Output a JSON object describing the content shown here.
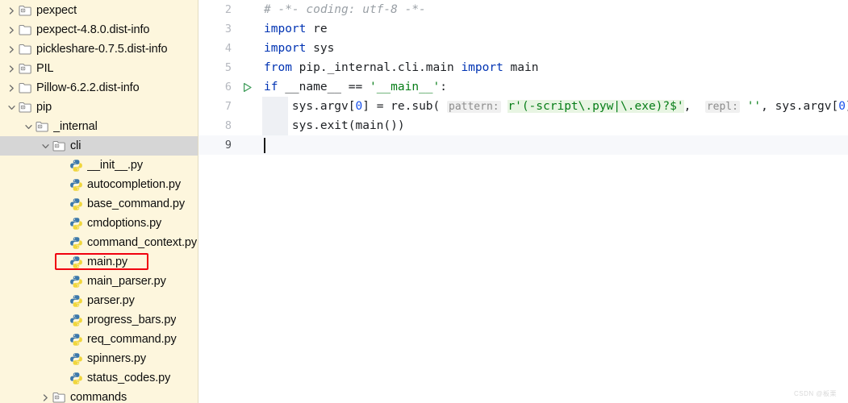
{
  "sidebar": {
    "background_color": "#fdf6dd",
    "selected_row_color": "#d6d6d6",
    "annotation_color": "#f0000f",
    "items": [
      {
        "label": "pexpect",
        "indent": 0,
        "arrow": "collapsed",
        "icon": "module-folder-icon",
        "selected": false,
        "annotated": false
      },
      {
        "label": "pexpect-4.8.0.dist-info",
        "indent": 0,
        "arrow": "collapsed",
        "icon": "folder-icon",
        "selected": false,
        "annotated": false
      },
      {
        "label": "pickleshare-0.7.5.dist-info",
        "indent": 0,
        "arrow": "collapsed",
        "icon": "folder-icon",
        "selected": false,
        "annotated": false
      },
      {
        "label": "PIL",
        "indent": 0,
        "arrow": "collapsed",
        "icon": "module-folder-icon",
        "selected": false,
        "annotated": false
      },
      {
        "label": "Pillow-6.2.2.dist-info",
        "indent": 0,
        "arrow": "collapsed",
        "icon": "folder-icon",
        "selected": false,
        "annotated": false
      },
      {
        "label": "pip",
        "indent": 0,
        "arrow": "expanded",
        "icon": "module-folder-icon",
        "selected": false,
        "annotated": false
      },
      {
        "label": "_internal",
        "indent": 1,
        "arrow": "expanded",
        "icon": "module-folder-icon",
        "selected": false,
        "annotated": false
      },
      {
        "label": "cli",
        "indent": 2,
        "arrow": "expanded",
        "icon": "module-folder-icon",
        "selected": true,
        "annotated": false
      },
      {
        "label": "__init__.py",
        "indent": 3,
        "arrow": "none",
        "icon": "python-file-icon",
        "selected": false,
        "annotated": false
      },
      {
        "label": "autocompletion.py",
        "indent": 3,
        "arrow": "none",
        "icon": "python-file-icon",
        "selected": false,
        "annotated": false
      },
      {
        "label": "base_command.py",
        "indent": 3,
        "arrow": "none",
        "icon": "python-file-icon",
        "selected": false,
        "annotated": false
      },
      {
        "label": "cmdoptions.py",
        "indent": 3,
        "arrow": "none",
        "icon": "python-file-icon",
        "selected": false,
        "annotated": false
      },
      {
        "label": "command_context.py",
        "indent": 3,
        "arrow": "none",
        "icon": "python-file-icon",
        "selected": false,
        "annotated": false
      },
      {
        "label": "main.py",
        "indent": 3,
        "arrow": "none",
        "icon": "python-file-icon",
        "selected": false,
        "annotated": true
      },
      {
        "label": "main_parser.py",
        "indent": 3,
        "arrow": "none",
        "icon": "python-file-icon",
        "selected": false,
        "annotated": false
      },
      {
        "label": "parser.py",
        "indent": 3,
        "arrow": "none",
        "icon": "python-file-icon",
        "selected": false,
        "annotated": false
      },
      {
        "label": "progress_bars.py",
        "indent": 3,
        "arrow": "none",
        "icon": "python-file-icon",
        "selected": false,
        "annotated": false
      },
      {
        "label": "req_command.py",
        "indent": 3,
        "arrow": "none",
        "icon": "python-file-icon",
        "selected": false,
        "annotated": false
      },
      {
        "label": "spinners.py",
        "indent": 3,
        "arrow": "none",
        "icon": "python-file-icon",
        "selected": false,
        "annotated": false
      },
      {
        "label": "status_codes.py",
        "indent": 3,
        "arrow": "none",
        "icon": "python-file-icon",
        "selected": false,
        "annotated": false
      },
      {
        "label": "commands",
        "indent": 2,
        "arrow": "collapsed",
        "icon": "module-folder-icon",
        "selected": false,
        "annotated": false
      }
    ]
  },
  "editor": {
    "current_line": 9,
    "run_marker_line": 6,
    "caret_line": 9,
    "lines": [
      {
        "number": "2",
        "run_marker": false,
        "indent_guide": false,
        "current": false,
        "tokens": [
          {
            "text": "# -*- coding: utf-8 -*-",
            "cls": "t-comment"
          }
        ]
      },
      {
        "number": "3",
        "run_marker": false,
        "indent_guide": false,
        "current": false,
        "tokens": [
          {
            "text": "import",
            "cls": "t-kw"
          },
          {
            "text": " re",
            "cls": "t-plain"
          }
        ]
      },
      {
        "number": "4",
        "run_marker": false,
        "indent_guide": false,
        "current": false,
        "tokens": [
          {
            "text": "import",
            "cls": "t-kw"
          },
          {
            "text": " sys",
            "cls": "t-plain"
          }
        ]
      },
      {
        "number": "5",
        "run_marker": false,
        "indent_guide": false,
        "current": false,
        "tokens": [
          {
            "text": "from",
            "cls": "t-kw"
          },
          {
            "text": " pip._internal.cli.main ",
            "cls": "t-plain"
          },
          {
            "text": "import",
            "cls": "t-kw"
          },
          {
            "text": " main",
            "cls": "t-plain"
          }
        ]
      },
      {
        "number": "6",
        "run_marker": true,
        "indent_guide": false,
        "current": false,
        "tokens": [
          {
            "text": "if",
            "cls": "t-kw"
          },
          {
            "text": " __name__ == ",
            "cls": "t-plain"
          },
          {
            "text": "'__main__'",
            "cls": "t-str"
          },
          {
            "text": ":",
            "cls": "t-plain"
          }
        ]
      },
      {
        "number": "7",
        "run_marker": false,
        "indent_guide": true,
        "current": false,
        "tokens": [
          {
            "text": "    sys.argv[",
            "cls": "t-plain"
          },
          {
            "text": "0",
            "cls": "t-num"
          },
          {
            "text": "] = re.sub( ",
            "cls": "t-plain"
          },
          {
            "text": "pattern:",
            "cls": "t-paramhint"
          },
          {
            "text": " ",
            "cls": "t-plain"
          },
          {
            "text": "r'(-script\\.pyw|\\.exe)?$'",
            "cls": "t-strhl"
          },
          {
            "text": ",  ",
            "cls": "t-plain"
          },
          {
            "text": "repl:",
            "cls": "t-paramhint"
          },
          {
            "text": " ",
            "cls": "t-plain"
          },
          {
            "text": "''",
            "cls": "t-str"
          },
          {
            "text": ", sys.argv[",
            "cls": "t-plain"
          },
          {
            "text": "0",
            "cls": "t-num"
          },
          {
            "text": "])",
            "cls": "t-plain"
          }
        ]
      },
      {
        "number": "8",
        "run_marker": false,
        "indent_guide": true,
        "current": false,
        "tokens": [
          {
            "text": "    sys.exit(main())",
            "cls": "t-plain"
          }
        ]
      },
      {
        "number": "9",
        "run_marker": false,
        "indent_guide": false,
        "current": true,
        "caret": true,
        "tokens": [
          {
            "text": "",
            "cls": "t-plain"
          }
        ]
      }
    ]
  },
  "watermark": {
    "text": "CSDN @板栗"
  }
}
